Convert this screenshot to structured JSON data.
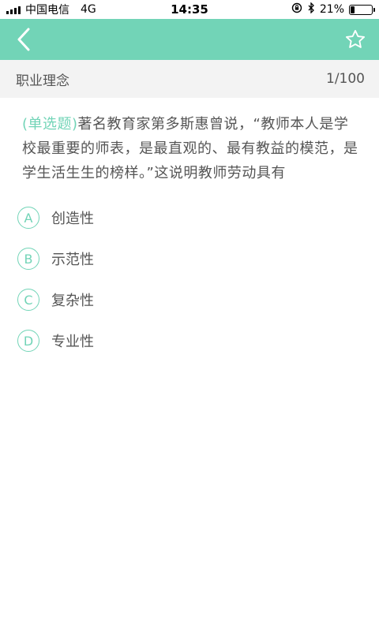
{
  "status_bar": {
    "carrier": "中国电信",
    "network": "4G",
    "time": "14:35",
    "battery_percent": "21%",
    "battery_level": 0.21,
    "icons": [
      "signal-icon",
      "orientation-lock-icon",
      "bluetooth-icon",
      "battery-icon"
    ]
  },
  "nav": {
    "back_icon": "chevron-left-icon",
    "favorite_icon": "star-outline-icon",
    "background_color": "#72d4b7"
  },
  "subheader": {
    "category": "职业理念",
    "progress": "1/100"
  },
  "question": {
    "type": "(单选题)",
    "text": "著名教育家第多斯惠曾说，“教师本人是学校最重要的师表，是最直观的、最有教益的模范，是学生活生生的榜样。”这说明教师劳动具有"
  },
  "options": [
    {
      "letter": "A",
      "text": "创造性"
    },
    {
      "letter": "B",
      "text": "示范性"
    },
    {
      "letter": "C",
      "text": "复杂性"
    },
    {
      "letter": "D",
      "text": "专业性"
    }
  ],
  "colors": {
    "accent": "#72d4b7",
    "subheader_bg": "#f3f3f3",
    "text": "#555555"
  }
}
